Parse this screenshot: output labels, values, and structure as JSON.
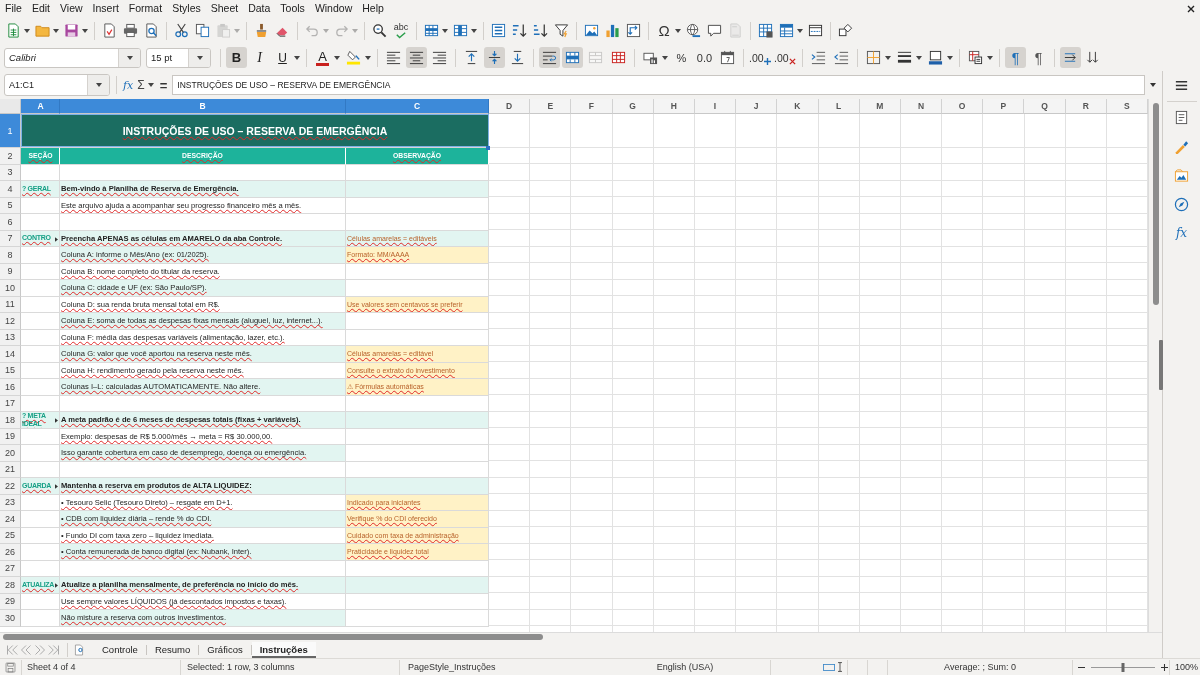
{
  "menu_bar": [
    "File",
    "Edit",
    "View",
    "Insert",
    "Format",
    "Styles",
    "Sheet",
    "Data",
    "Tools",
    "Window",
    "Help"
  ],
  "standard_toolbar": {
    "paste_disabled": true,
    "undo_disabled": true,
    "redo_disabled": true,
    "header_footer_disabled": true,
    "spellcheck_glyph": "abc",
    "special_character_glyph": "Ω"
  },
  "formatting_toolbar": {
    "font_name": "Calibri",
    "font_size": "15 pt",
    "bold": {
      "glyph": "B",
      "on": true
    },
    "italic": {
      "glyph": "I",
      "on": false
    },
    "underline": {
      "glyph": "U",
      "on": false
    },
    "font_color_glyph": "A",
    "horizontal_align": {
      "left": false,
      "center": true,
      "right": false
    },
    "vertical_align": {
      "top": false,
      "center": true,
      "bottom": false
    },
    "wrap_text": true,
    "merge_and_center": true,
    "merge_cells_disabled": true,
    "percent_glyph": "%",
    "standard_format_glyph": "0.0",
    "add_decimal_glyph": ".00",
    "delete_decimal_glyph": ".00",
    "left_to_right": {
      "glyph": "¶",
      "on": true
    },
    "right_to_left": {
      "glyph": "¶",
      "on": false
    },
    "text_direction": {
      "horizontal": true,
      "vertical": false
    }
  },
  "formula_bar": {
    "name_box": "A1:C1",
    "function_glyph": "fx",
    "sum_glyph": "Σ",
    "equals_glyph": "=",
    "content": "INSTRUÇÕES DE USO – RESERVA DE EMERGÊNCIA"
  },
  "sidebar": {
    "functions_glyph": "fx"
  },
  "sheet": {
    "spelling_marks": true,
    "columns": [
      {
        "label": "A",
        "selected": true
      },
      {
        "label": "B",
        "selected": true
      },
      {
        "label": "C",
        "selected": true
      },
      {
        "label": "D",
        "selected": false
      },
      {
        "label": "E",
        "selected": false
      },
      {
        "label": "F",
        "selected": false
      },
      {
        "label": "G",
        "selected": false
      },
      {
        "label": "H",
        "selected": false
      },
      {
        "label": "I",
        "selected": false
      },
      {
        "label": "J",
        "selected": false
      },
      {
        "label": "K",
        "selected": false
      },
      {
        "label": "L",
        "selected": false
      },
      {
        "label": "M",
        "selected": false
      },
      {
        "label": "N",
        "selected": false
      },
      {
        "label": "O",
        "selected": false
      },
      {
        "label": "P",
        "selected": false
      },
      {
        "label": "Q",
        "selected": false
      },
      {
        "label": "R",
        "selected": false
      },
      {
        "label": "S",
        "selected": false
      }
    ],
    "title_row": {
      "number": "1",
      "selected": true,
      "text": "INSTRUÇÕES DE USO – RESERVA DE EMERGÊNCIA"
    },
    "header_row": {
      "number": "2",
      "selected": false,
      "cells": [
        "SEÇÃO",
        "DESCRIÇÃO",
        "OBSERVAÇÃO"
      ]
    },
    "rows": [
      {
        "number": "3",
        "selected": false,
        "kind": "blank",
        "shaded": false
      },
      {
        "number": "4",
        "selected": false,
        "kind": "heading",
        "shaded": true,
        "section": {
          "text": "? GERAL",
          "overflow": false
        },
        "description": "Bem-vindo à Planilha de Reserva de Emergência."
      },
      {
        "number": "5",
        "selected": false,
        "kind": "item",
        "shaded": false,
        "description": "Este arquivo ajuda a acompanhar seu progresso financeiro mês a mês."
      },
      {
        "number": "6",
        "selected": false,
        "kind": "blank",
        "shaded": false
      },
      {
        "number": "7",
        "selected": false,
        "kind": "heading",
        "shaded": true,
        "section": {
          "text": "CONTRO",
          "overflow": true
        },
        "description": "Preencha APENAS as células em AMARELO da aba Controle.",
        "note": {
          "text": "Células amarelas = editáveis",
          "highlighted": false
        }
      },
      {
        "number": "8",
        "selected": false,
        "kind": "item",
        "shaded": true,
        "description": "Coluna A: informe o Mês/Ano (ex: 01/2025).",
        "note": {
          "text": "Formato: MM/AAAA",
          "highlighted": true
        }
      },
      {
        "number": "9",
        "selected": false,
        "kind": "item",
        "shaded": false,
        "description": "Coluna B: nome completo do titular da reserva."
      },
      {
        "number": "10",
        "selected": false,
        "kind": "item",
        "shaded": true,
        "description": "Coluna C: cidade e UF (ex: São Paulo/SP)."
      },
      {
        "number": "11",
        "selected": false,
        "kind": "item",
        "shaded": false,
        "description": "Coluna D: sua renda bruta mensal total em R$.",
        "note": {
          "text": "Use valores sem centavos se preferir",
          "highlighted": true
        }
      },
      {
        "number": "12",
        "selected": false,
        "kind": "item",
        "shaded": true,
        "description": "Coluna E: soma de todas as despesas fixas mensais (aluguel, luz, internet...)."
      },
      {
        "number": "13",
        "selected": false,
        "kind": "item",
        "shaded": false,
        "description": "Coluna F: média das despesas variáveis (alimentação, lazer, etc.)."
      },
      {
        "number": "14",
        "selected": false,
        "kind": "item",
        "shaded": true,
        "description": "Coluna G: valor que você aportou na reserva neste mês.",
        "note": {
          "text": "Células amarelas = editável",
          "highlighted": true
        }
      },
      {
        "number": "15",
        "selected": false,
        "kind": "item",
        "shaded": false,
        "description": "Coluna H: rendimento gerado pela reserva neste mês.",
        "note": {
          "text": "Consulte o extrato do investimento",
          "highlighted": true
        }
      },
      {
        "number": "16",
        "selected": false,
        "kind": "item",
        "shaded": true,
        "description": "Colunas I–L: calculadas AUTOMATICAMENTE. Não altere.",
        "note": {
          "text": "⚠ Fórmulas automáticas",
          "highlighted": true
        }
      },
      {
        "number": "17",
        "selected": false,
        "kind": "blank",
        "shaded": false
      },
      {
        "number": "18",
        "selected": false,
        "kind": "heading",
        "shaded": true,
        "section": {
          "text": "? META IDEAL",
          "overflow": true
        },
        "description": "A meta padrão é de 6 meses de despesas totais (fixas + variáveis)."
      },
      {
        "number": "19",
        "selected": false,
        "kind": "item",
        "shaded": false,
        "description": "Exemplo: despesas de R$ 5.000/mês → meta = R$ 30.000,00."
      },
      {
        "number": "20",
        "selected": false,
        "kind": "item",
        "shaded": true,
        "description": "Isso garante cobertura em caso de desemprego, doença ou emergência."
      },
      {
        "number": "21",
        "selected": false,
        "kind": "blank",
        "shaded": false
      },
      {
        "number": "22",
        "selected": false,
        "kind": "heading",
        "shaded": true,
        "section": {
          "text": "GUARDA",
          "overflow": true
        },
        "description": "Mantenha a reserva em produtos de ALTA LIQUIDEZ:"
      },
      {
        "number": "23",
        "selected": false,
        "kind": "item",
        "shaded": false,
        "description": "• Tesouro Selic (Tesouro Direto) – resgate em D+1.",
        "note": {
          "text": "Indicado para iniciantes",
          "highlighted": true
        }
      },
      {
        "number": "24",
        "selected": false,
        "kind": "item",
        "shaded": true,
        "description": "• CDB com liquidez diária – rende % do CDI.",
        "note": {
          "text": "Verifique % do CDI oferecido",
          "highlighted": true
        }
      },
      {
        "number": "25",
        "selected": false,
        "kind": "item",
        "shaded": false,
        "description": "• Fundo DI com taxa zero – liquidez imediata.",
        "note": {
          "text": "Cuidado com taxa de administração",
          "highlighted": true
        }
      },
      {
        "number": "26",
        "selected": false,
        "kind": "item",
        "shaded": true,
        "description": "• Conta remunerada de banco digital (ex: Nubank, Inter).",
        "note": {
          "text": "Praticidade e liquidez total",
          "highlighted": true
        }
      },
      {
        "number": "27",
        "selected": false,
        "kind": "blank",
        "shaded": false
      },
      {
        "number": "28",
        "selected": false,
        "kind": "heading",
        "shaded": true,
        "section": {
          "text": "ATUALIZA",
          "overflow": true
        },
        "description": "Atualize a planilha mensalmente, de preferência no início do mês."
      },
      {
        "number": "29",
        "selected": false,
        "kind": "item",
        "shaded": false,
        "description": "Use sempre valores LÍQUIDOS (já descontados impostos e taxas)."
      },
      {
        "number": "30",
        "selected": false,
        "kind": "item",
        "shaded": true,
        "description": "Não misture a reserva com outros investimentos."
      }
    ]
  },
  "sheet_tabs": [
    {
      "label": "Controle",
      "selected": false
    },
    {
      "label": "Resumo",
      "selected": false
    },
    {
      "label": "Gráficos",
      "selected": false
    },
    {
      "label": "Instruções",
      "selected": true
    }
  ],
  "status_bar": {
    "sheet_position": "Sheet 4 of 4",
    "selection": "Selected: 1 row, 3 columns",
    "page_style": "PageStyle_Instruções",
    "language": "English (USA)",
    "summary": "Average: ; Sum: 0",
    "zoom": {
      "level": 0.5,
      "reading": "100%"
    }
  }
}
